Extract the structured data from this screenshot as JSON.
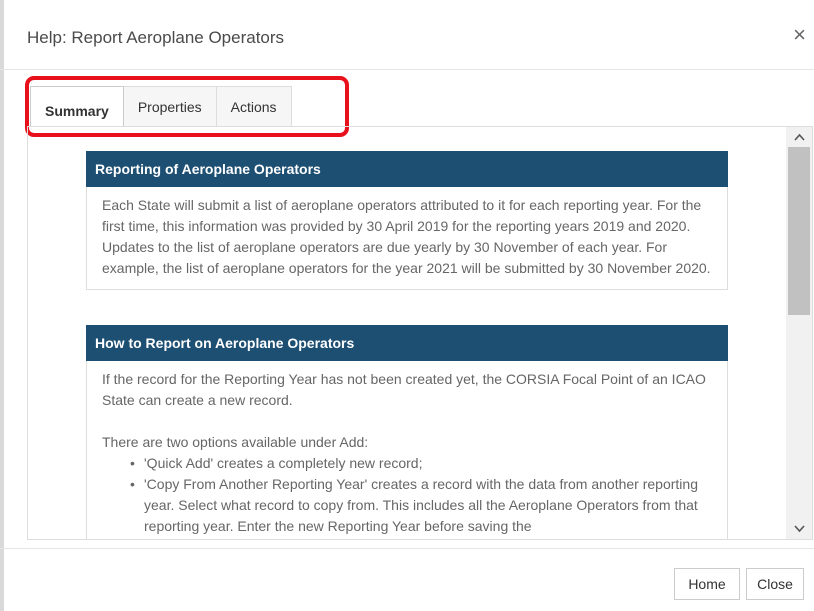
{
  "dialog": {
    "title": "Help: Report Aeroplane Operators",
    "close_glyph": "×"
  },
  "tabs": [
    {
      "label": "Summary",
      "active": true
    },
    {
      "label": "Properties",
      "active": false
    },
    {
      "label": "Actions",
      "active": false
    }
  ],
  "sections": [
    {
      "heading": "Reporting of Aeroplane Operators",
      "paragraphs": [
        "Each State will submit a list of aeroplane operators attributed to it for each reporting year. For the first time, this information was provided by 30 April 2019 for the reporting years 2019 and 2020. Updates to the list of aeroplane operators are due yearly by 30 November of each year.  For example, the list of aeroplane operators for the year 2021 will be submitted by 30 November 2020."
      ]
    },
    {
      "heading": "How to Report on Aeroplane Operators",
      "paragraphs": [
        "If the record for the Reporting Year has not been created yet, the CORSIA Focal Point of an ICAO State can create a new record.",
        "There are two options available under Add:"
      ],
      "bullets": [
        "'Quick Add' creates a completely new record;",
        "'Copy From Another Reporting Year' creates a record with the data from another reporting year. Select what record to copy from. This includes all the Aeroplane Operators from that reporting year. Enter the new Reporting Year before saving the"
      ]
    }
  ],
  "scrollbar": {
    "up_glyph": "^",
    "down_glyph": "v"
  },
  "footer": {
    "home_label": "Home",
    "close_label": "Close"
  },
  "colors": {
    "section_header_bg": "#1d4f73",
    "highlight_border": "#e8101a"
  },
  "icons": [
    "close-icon",
    "scroll-up-icon",
    "scroll-down-icon"
  ]
}
